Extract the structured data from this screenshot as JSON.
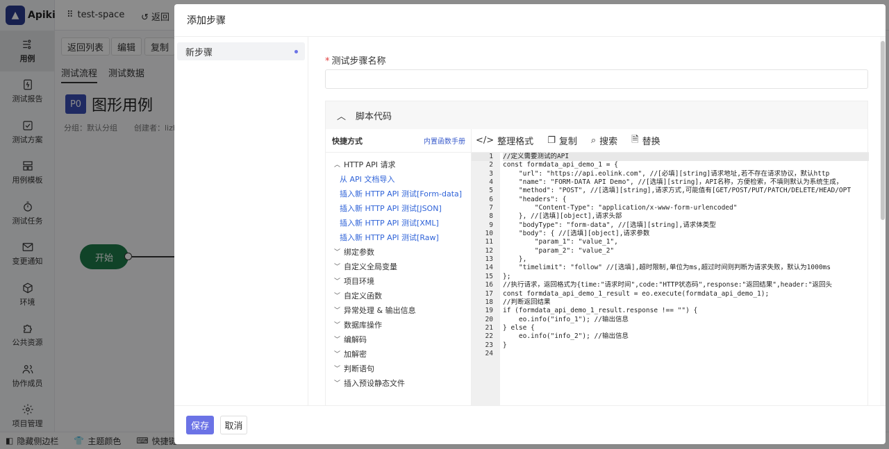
{
  "app": {
    "name": "Apikit",
    "logo_glyph": "▲",
    "space": "test-space",
    "back_top": "返回"
  },
  "sidebar": {
    "items": [
      {
        "label": "用例",
        "icon": "flow-icon",
        "active": true
      },
      {
        "label": "测试报告",
        "icon": "report-icon"
      },
      {
        "label": "测试方案",
        "icon": "plan-icon"
      },
      {
        "label": "用例模板",
        "icon": "template-icon"
      },
      {
        "label": "测试任务",
        "icon": "timer-icon"
      },
      {
        "label": "变更通知",
        "icon": "mail-icon"
      },
      {
        "label": "环境",
        "icon": "cube-icon"
      },
      {
        "label": "公共资源",
        "icon": "puzzle-icon"
      },
      {
        "label": "协作成员",
        "icon": "users-icon"
      },
      {
        "label": "项目管理",
        "icon": "gear-icon"
      }
    ]
  },
  "toolbar": {
    "back_list": "返回列表",
    "edit": "编辑",
    "copy": "复制"
  },
  "tabs": [
    "测试流程",
    "测试数据"
  ],
  "case": {
    "priority": "P0",
    "name": "图形用例",
    "group": "分组：默认分组",
    "creator": "创建者：lizhu"
  },
  "flow": {
    "start": "开始"
  },
  "bottombar": {
    "hide_sidebar": "隐藏侧边栏",
    "theme": "主题颜色",
    "shortcut": "快捷键"
  },
  "modal": {
    "title": "添加步骤",
    "steps": [
      {
        "label": "新步骤"
      }
    ],
    "step_name_label": "测试步骤名称",
    "step_name_value": "",
    "panel_title": "脚本代码",
    "quick": {
      "title": "快捷方式",
      "manual": "内置函数手册",
      "nodes": [
        {
          "label": "HTTP API 请求",
          "expanded": true,
          "children": [
            "从 API 文档导入",
            "插入新 HTTP API 测试[Form-data]",
            "插入新 HTTP API 测试[JSON]",
            "插入新 HTTP API 测试[XML]",
            "插入新 HTTP API 测试[Raw]"
          ]
        },
        {
          "label": "绑定参数"
        },
        {
          "label": "自定义全局变量"
        },
        {
          "label": "项目环境"
        },
        {
          "label": "自定义函数"
        },
        {
          "label": "异常处理 & 输出信息"
        },
        {
          "label": "数据库操作"
        },
        {
          "label": "编解码"
        },
        {
          "label": "加解密"
        },
        {
          "label": "判断语句"
        },
        {
          "label": "插入预设静态文件"
        }
      ]
    },
    "editor_tools": {
      "format": "整理格式",
      "copy": "复制",
      "search": "搜索",
      "replace": "替换"
    },
    "code_lines": [
      "//定义需要测试的API",
      "const formdata_api_demo_1 = {",
      "    \"url\": \"https://api.eolink.com\", //[必填][string]请求地址,若不存在请求协议，默认http",
      "    \"name\": \"FORM-DATA API Demo\", //[选填][string]，API名称，方便检索，不填则默认为系统生成，",
      "    \"method\": \"POST\", //[选填][string],请求方式,可能值有[GET/POST/PUT/PATCH/DELETE/HEAD/OPT",
      "    \"headers\": {",
      "        \"Content-Type\": \"application/x-www-form-urlencoded\"",
      "    }, //[选填][object],请求头部",
      "    \"bodyType\": \"form-data\", //[选填][string],请求体类型",
      "    \"body\": { //[选填][object],请求参数",
      "        \"param_1\": \"value_1\",",
      "        \"param_2\": \"value_2\"",
      "    },",
      "    \"timelimit\": \"follow\" //[选填],超时限制,单位为ms,超过时间则判断为请求失败，默认为1000ms",
      "};",
      "//执行请求，返回格式为{time:\"请求时间\",code:\"HTTP状态码\",response:\"返回结果\",header:\"返回头",
      "const formdata_api_demo_1_result = eo.execute(formdata_api_demo_1);",
      "//判断返回结果",
      "if (formdata_api_demo_1_result.response !== \"\") {",
      "    eo.info(\"info_1\"); //输出信息",
      "} else {",
      "    eo.info(\"info_2\"); //输出信息",
      "}",
      ""
    ],
    "save": "保存",
    "cancel": "取消"
  },
  "colors": {
    "primary": "#6b73e6",
    "start_node": "#1e7a4a",
    "link": "#2f63d8"
  }
}
